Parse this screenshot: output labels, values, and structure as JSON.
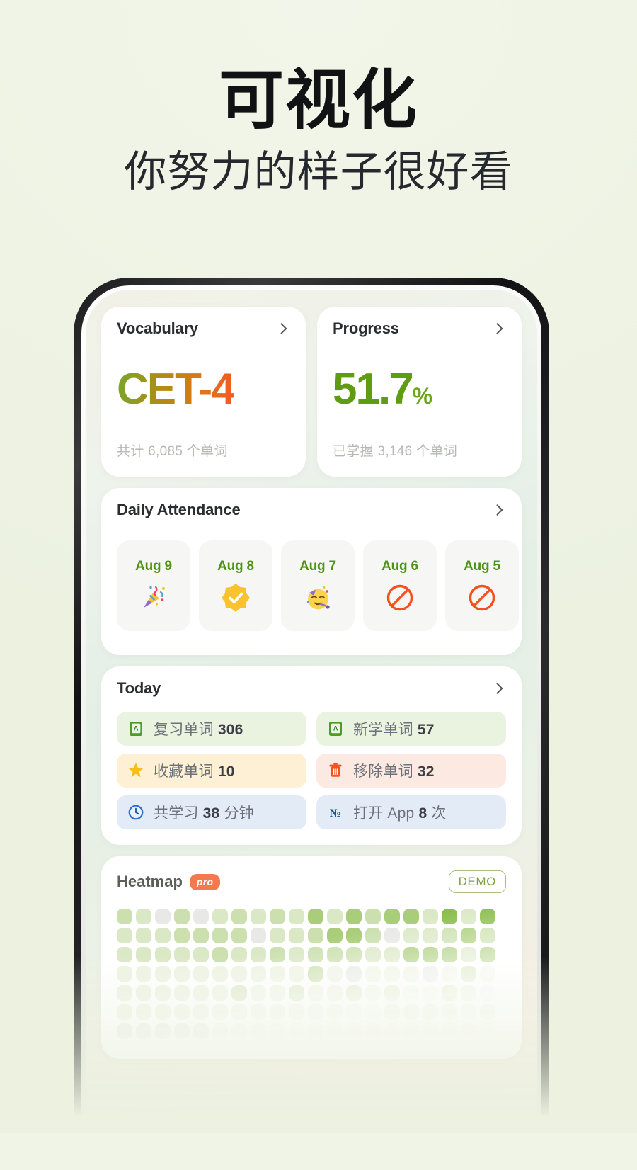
{
  "hero": {
    "headline": "可视化",
    "subheadline": "你努力的样子很好看"
  },
  "colors": {
    "page_bg": "#f0f4e6",
    "accent_green": "#5f9c14",
    "accent_orange": "#f4794f",
    "date_green": "#4f9216",
    "heat_empty": "#e8e9e6"
  },
  "app": {
    "vocabulary_card": {
      "title": "Vocabulary",
      "chevron": "chevron-right-icon",
      "value": "CET-4",
      "subtitle": "共计 6,085 个单词"
    },
    "progress_card": {
      "title": "Progress",
      "chevron": "chevron-right-icon",
      "value": "51.7",
      "unit": "%",
      "subtitle": "已掌握 3,146 个单词"
    },
    "attendance_card": {
      "title": "Daily Attendance",
      "chevron": "chevron-right-icon",
      "days": [
        {
          "date": "Aug 9",
          "icon": "party-popper-icon",
          "emoji": "🎉"
        },
        {
          "date": "Aug 8",
          "icon": "verified-check-icon",
          "emoji": "✅"
        },
        {
          "date": "Aug 7",
          "icon": "partying-face-icon",
          "emoji": "🥳"
        },
        {
          "date": "Aug 6",
          "icon": "prohibited-icon",
          "emoji": "🚫"
        },
        {
          "date": "Aug 5",
          "icon": "prohibited-icon",
          "emoji": "🚫"
        }
      ]
    },
    "today_card": {
      "title": "Today",
      "chevron": "chevron-right-icon",
      "stats": [
        {
          "icon": "green-book-icon",
          "tone": "green",
          "label": "复习单词",
          "value": "306"
        },
        {
          "icon": "green-book-icon",
          "tone": "green",
          "label": "新学单词",
          "value": "57"
        },
        {
          "icon": "star-icon",
          "tone": "yellow",
          "label": "收藏单词",
          "value": "10"
        },
        {
          "icon": "trash-icon",
          "tone": "red",
          "label": "移除单词",
          "value": "32"
        },
        {
          "icon": "clock-icon",
          "tone": "blue",
          "label": "共学习",
          "value": "38",
          "suffix": "分钟"
        },
        {
          "icon": "numero-icon",
          "tone": "blue",
          "label": "打开 App",
          "value": "8",
          "suffix": "次"
        }
      ]
    },
    "heatmap_card": {
      "title": "Heatmap",
      "pro_badge": "pro",
      "demo_badge": "DEMO",
      "columns": 20,
      "rows": 7,
      "levels": [
        [
          3,
          2,
          0,
          3,
          0,
          2,
          3,
          2,
          3,
          2,
          4,
          2,
          4,
          3,
          4,
          4,
          2,
          5,
          2,
          5
        ],
        [
          2,
          2,
          2,
          3,
          3,
          3,
          3,
          0,
          2,
          2,
          3,
          4,
          4,
          3,
          0,
          2,
          2,
          3,
          4,
          3
        ],
        [
          2,
          2,
          2,
          2,
          2,
          3,
          2,
          2,
          3,
          2,
          3,
          3,
          3,
          2,
          2,
          4,
          4,
          4,
          2,
          4
        ],
        [
          1,
          1,
          1,
          1,
          1,
          1,
          1,
          1,
          1,
          1,
          3,
          1,
          0,
          1,
          1,
          1,
          0,
          1,
          3,
          1
        ],
        [
          1,
          1,
          1,
          1,
          1,
          1,
          2,
          1,
          1,
          2,
          1,
          1,
          2,
          1,
          2,
          1,
          1,
          3,
          2,
          0
        ],
        [
          1,
          1,
          1,
          1,
          1,
          1,
          1,
          1,
          1,
          1,
          1,
          1,
          1,
          1,
          2,
          2,
          2,
          2,
          2,
          3
        ],
        [
          0,
          0,
          0,
          0,
          0,
          1,
          1,
          1,
          1,
          1,
          1,
          1,
          1,
          1,
          1,
          2,
          2,
          2,
          2,
          2
        ]
      ],
      "palette": [
        "#e8e9e6",
        "#eef3e4",
        "#dbe8c6",
        "#cbe0ae",
        "#a9cd78",
        "#8bbe4e",
        "#74ad2f"
      ]
    }
  }
}
